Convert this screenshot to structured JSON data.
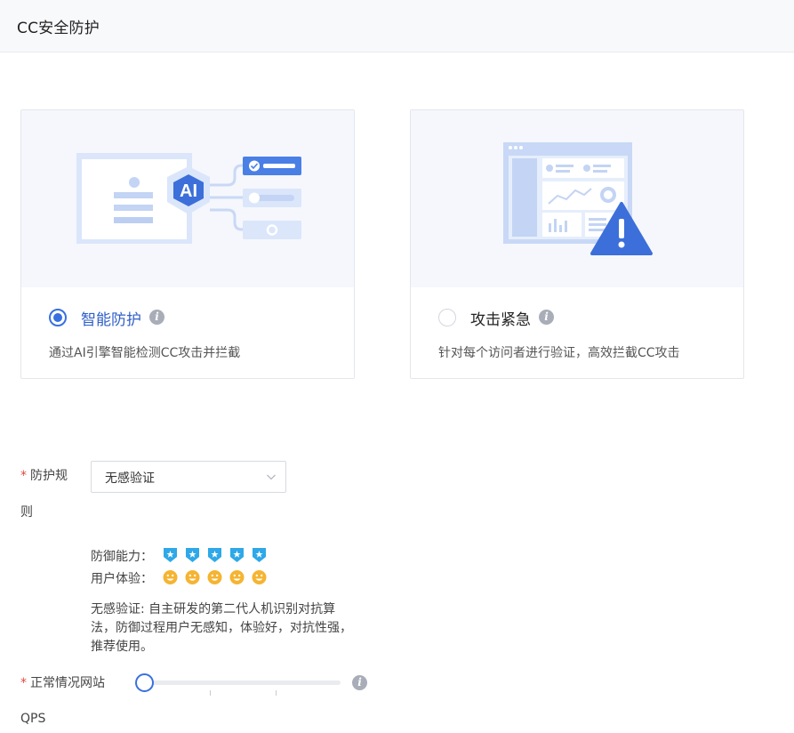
{
  "header": {
    "title": "CC安全防护"
  },
  "modes": [
    {
      "title": "智能防护",
      "description": "通过AI引擎智能检测CC攻击并拦截",
      "selected": true,
      "badge": "AI"
    },
    {
      "title": "攻击紧急",
      "description": "针对每个访问者进行验证，高效拦截CC攻击",
      "selected": false
    }
  ],
  "rule": {
    "label_line1": "防护规",
    "label_line2": "则",
    "selected": "无感验证",
    "defense_label": "防御能力：",
    "defense_level": 5,
    "experience_label": "用户体验：",
    "experience_level": 5,
    "description": "无感验证: 自主研发的第二代人机识别对抗算法，防御过程用户无感知，体验好，对抗性强，推荐使用。"
  },
  "qps": {
    "label_line1": "正常情况网站",
    "label_line2": "QPS",
    "value_fraction": 0
  },
  "colors": {
    "accent": "#3870e0",
    "shield": "#2ea8e8",
    "smile": "#f5b431",
    "required": "#e2483d"
  }
}
